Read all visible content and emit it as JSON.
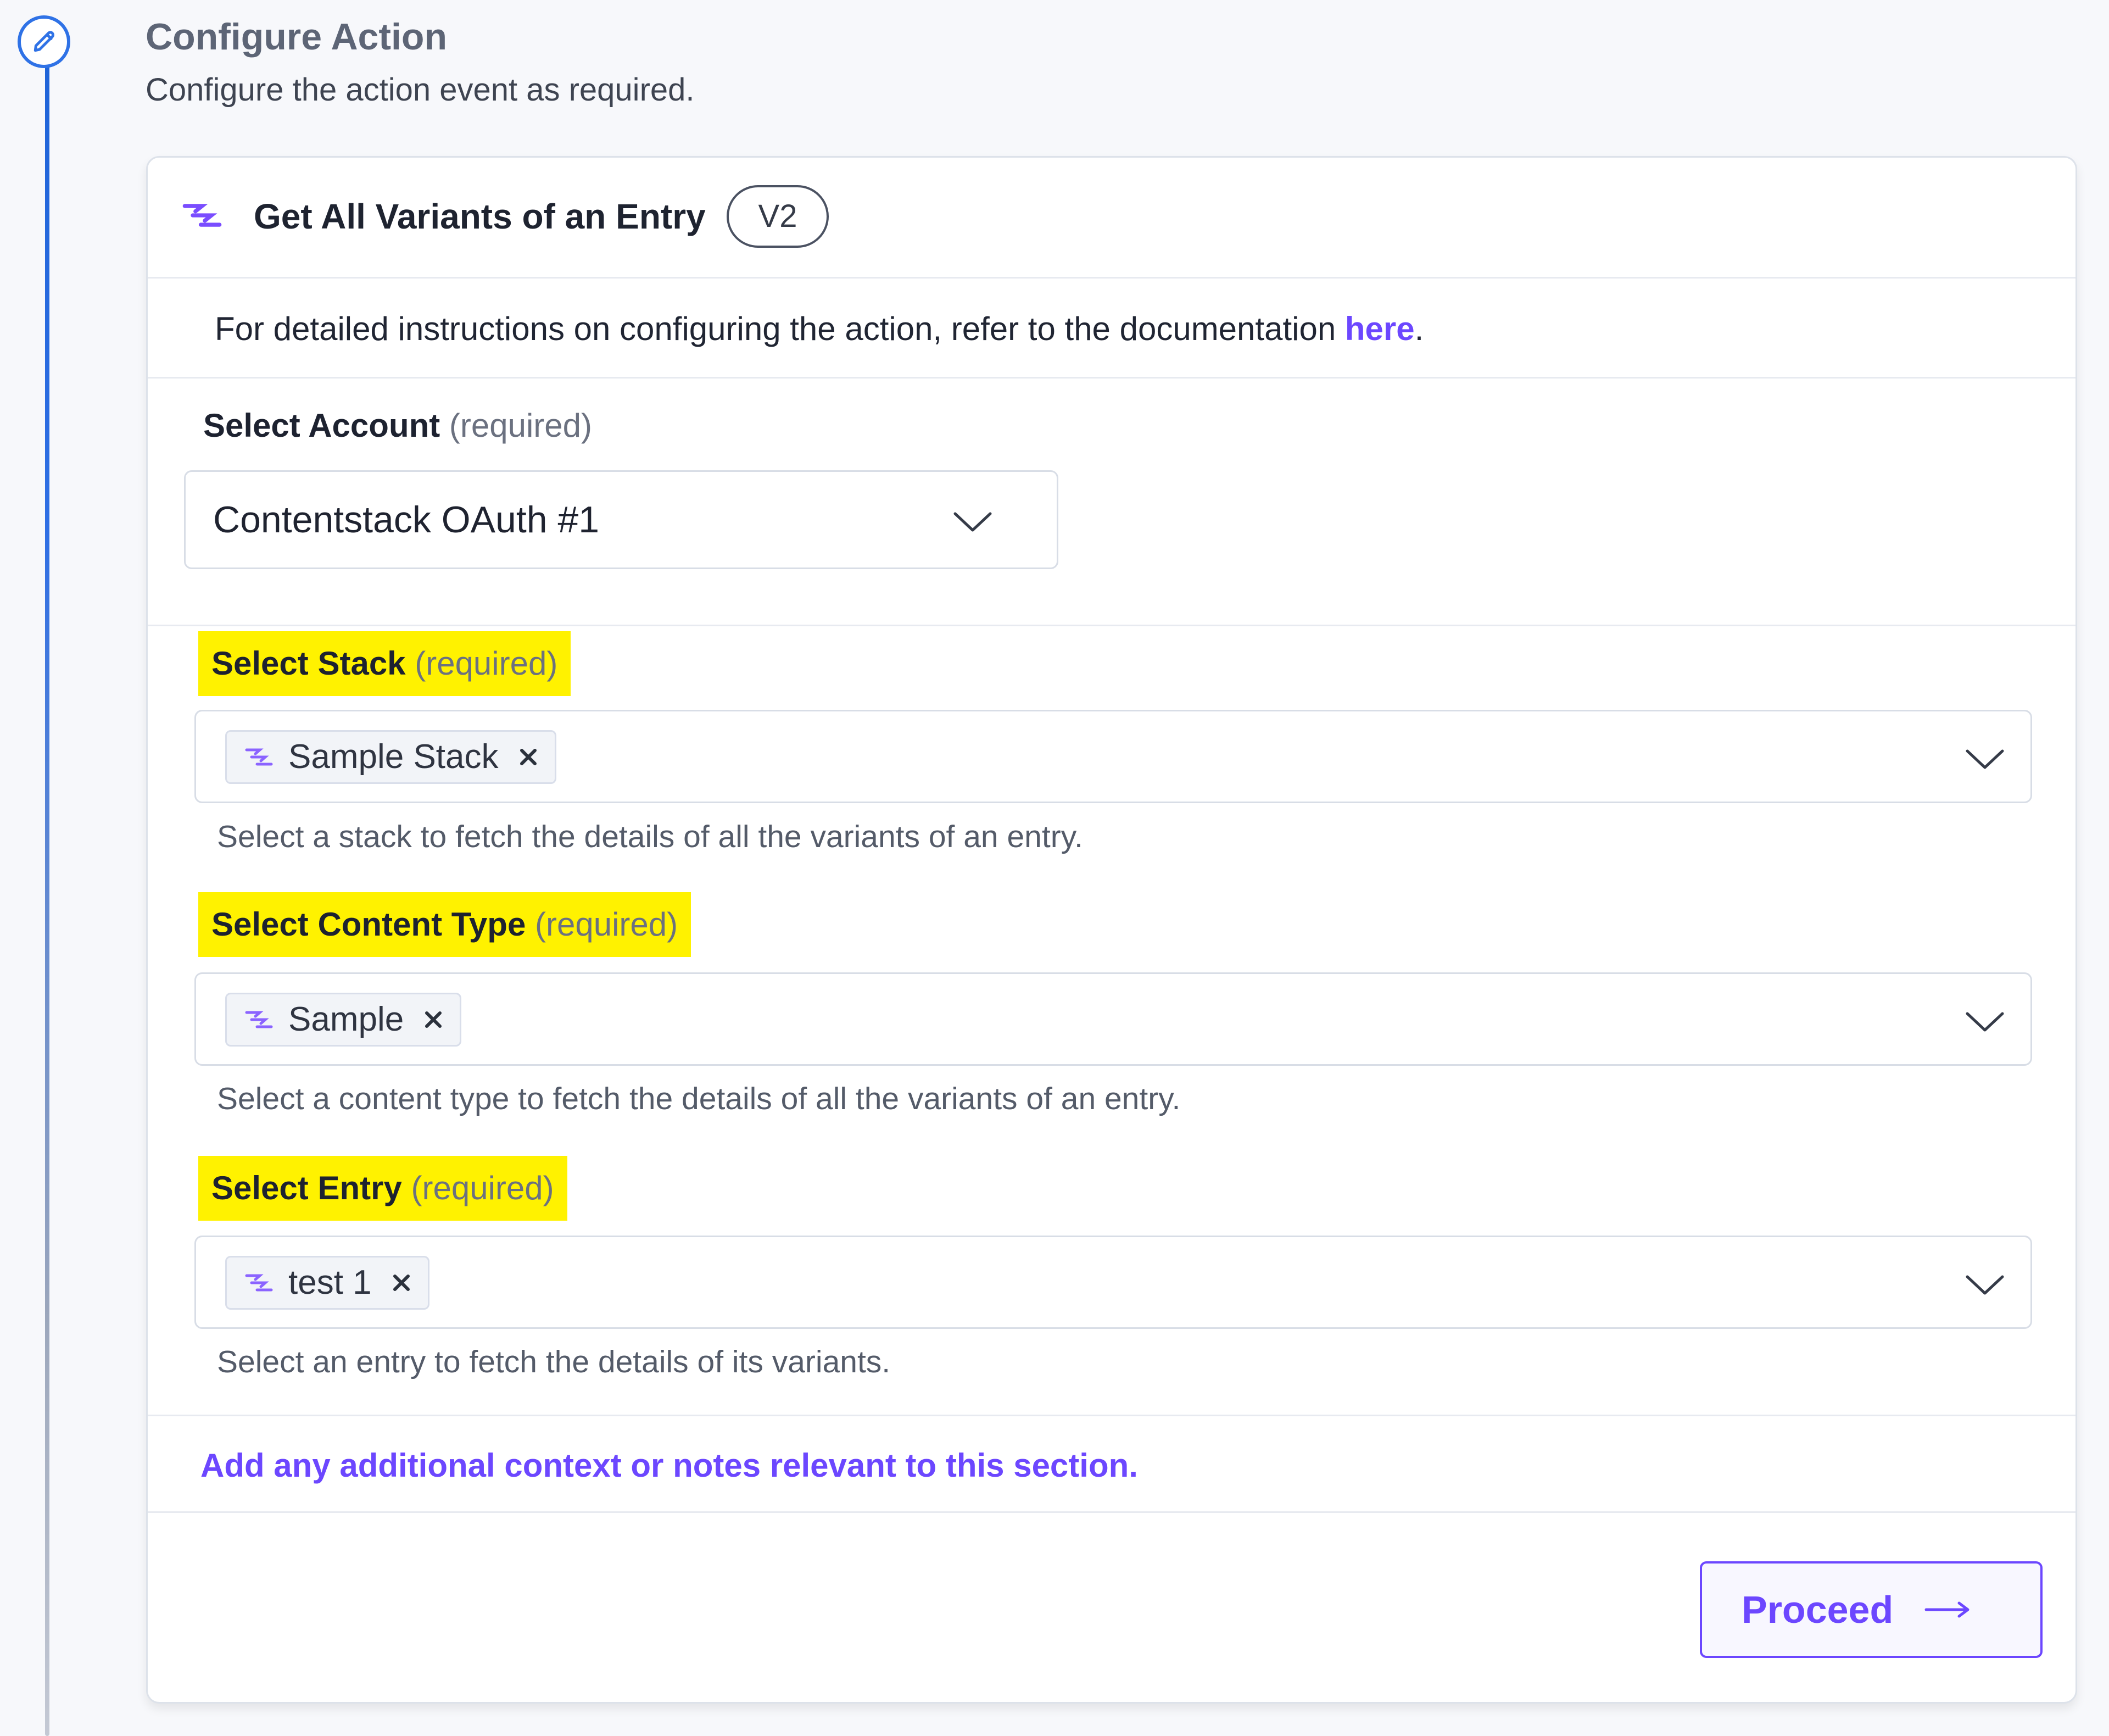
{
  "header": {
    "title": "Configure Action",
    "subtitle": "Configure the action event as required."
  },
  "card": {
    "title": "Get All Variants of an Entry",
    "version": "V2",
    "documentation": {
      "text": "For detailed instructions on configuring the action, refer to the documentation ",
      "link": "here",
      "suffix": "."
    },
    "account": {
      "label": "Select Account",
      "required": "(required)",
      "value": "Contentstack OAuth #1"
    },
    "stack": {
      "label": "Select Stack",
      "required": "(required)",
      "chip": "Sample Stack",
      "helper": "Select a stack to fetch the details of all the variants of an entry."
    },
    "content_type": {
      "label": "Select Content Type",
      "required": "(required)",
      "chip": "Sample",
      "helper": "Select a content type to fetch the details of all the variants of an entry."
    },
    "entry": {
      "label": "Select Entry",
      "required": "(required)",
      "chip": "test 1",
      "helper": "Select an entry to fetch the details of its variants."
    },
    "notes": "Add any additional context or notes relevant to this section.",
    "proceed_label": "Proceed"
  },
  "icons": {
    "step": "pencil-icon",
    "action": "contentstack-logo-icon",
    "chip": "contentstack-logo-icon",
    "remove": "close-icon",
    "dropdown": "chevron-down-icon",
    "next": "arrow-right-icon"
  },
  "colors": {
    "accent": "#6c47ff",
    "timeline": "#2f72e6",
    "highlight": "#fff200"
  }
}
